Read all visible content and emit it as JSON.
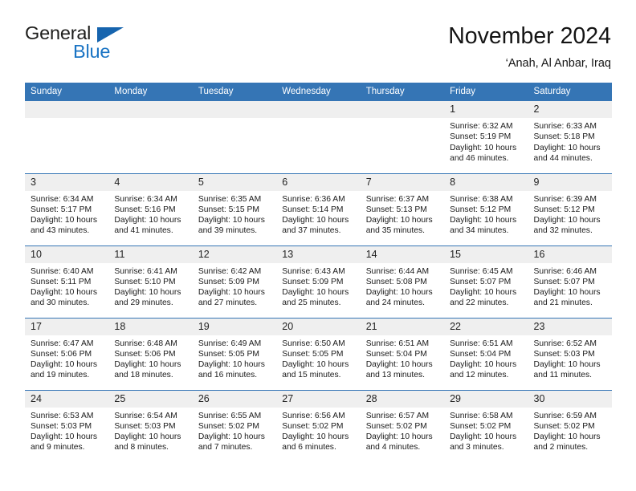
{
  "brand": {
    "name_part1": "General",
    "name_part2": "Blue",
    "triangle_icon": "triangle-icon",
    "color_dark": "#1d1d1b",
    "color_blue": "#1a74c4"
  },
  "header": {
    "title": "November 2024",
    "subtitle": "‘Anah, Al Anbar, Iraq",
    "accent_color": "#3575b5",
    "daynum_bg": "#efefef"
  },
  "weekday_headers": [
    "Sunday",
    "Monday",
    "Tuesday",
    "Wednesday",
    "Thursday",
    "Friday",
    "Saturday"
  ],
  "weeks": [
    [
      {
        "day": "",
        "sunrise": "",
        "sunset": "",
        "daylight_line1": "",
        "daylight_line2": ""
      },
      {
        "day": "",
        "sunrise": "",
        "sunset": "",
        "daylight_line1": "",
        "daylight_line2": ""
      },
      {
        "day": "",
        "sunrise": "",
        "sunset": "",
        "daylight_line1": "",
        "daylight_line2": ""
      },
      {
        "day": "",
        "sunrise": "",
        "sunset": "",
        "daylight_line1": "",
        "daylight_line2": ""
      },
      {
        "day": "",
        "sunrise": "",
        "sunset": "",
        "daylight_line1": "",
        "daylight_line2": ""
      },
      {
        "day": "1",
        "sunrise": "Sunrise: 6:32 AM",
        "sunset": "Sunset: 5:19 PM",
        "daylight_line1": "Daylight: 10 hours",
        "daylight_line2": "and 46 minutes."
      },
      {
        "day": "2",
        "sunrise": "Sunrise: 6:33 AM",
        "sunset": "Sunset: 5:18 PM",
        "daylight_line1": "Daylight: 10 hours",
        "daylight_line2": "and 44 minutes."
      }
    ],
    [
      {
        "day": "3",
        "sunrise": "Sunrise: 6:34 AM",
        "sunset": "Sunset: 5:17 PM",
        "daylight_line1": "Daylight: 10 hours",
        "daylight_line2": "and 43 minutes."
      },
      {
        "day": "4",
        "sunrise": "Sunrise: 6:34 AM",
        "sunset": "Sunset: 5:16 PM",
        "daylight_line1": "Daylight: 10 hours",
        "daylight_line2": "and 41 minutes."
      },
      {
        "day": "5",
        "sunrise": "Sunrise: 6:35 AM",
        "sunset": "Sunset: 5:15 PM",
        "daylight_line1": "Daylight: 10 hours",
        "daylight_line2": "and 39 minutes."
      },
      {
        "day": "6",
        "sunrise": "Sunrise: 6:36 AM",
        "sunset": "Sunset: 5:14 PM",
        "daylight_line1": "Daylight: 10 hours",
        "daylight_line2": "and 37 minutes."
      },
      {
        "day": "7",
        "sunrise": "Sunrise: 6:37 AM",
        "sunset": "Sunset: 5:13 PM",
        "daylight_line1": "Daylight: 10 hours",
        "daylight_line2": "and 35 minutes."
      },
      {
        "day": "8",
        "sunrise": "Sunrise: 6:38 AM",
        "sunset": "Sunset: 5:12 PM",
        "daylight_line1": "Daylight: 10 hours",
        "daylight_line2": "and 34 minutes."
      },
      {
        "day": "9",
        "sunrise": "Sunrise: 6:39 AM",
        "sunset": "Sunset: 5:12 PM",
        "daylight_line1": "Daylight: 10 hours",
        "daylight_line2": "and 32 minutes."
      }
    ],
    [
      {
        "day": "10",
        "sunrise": "Sunrise: 6:40 AM",
        "sunset": "Sunset: 5:11 PM",
        "daylight_line1": "Daylight: 10 hours",
        "daylight_line2": "and 30 minutes."
      },
      {
        "day": "11",
        "sunrise": "Sunrise: 6:41 AM",
        "sunset": "Sunset: 5:10 PM",
        "daylight_line1": "Daylight: 10 hours",
        "daylight_line2": "and 29 minutes."
      },
      {
        "day": "12",
        "sunrise": "Sunrise: 6:42 AM",
        "sunset": "Sunset: 5:09 PM",
        "daylight_line1": "Daylight: 10 hours",
        "daylight_line2": "and 27 minutes."
      },
      {
        "day": "13",
        "sunrise": "Sunrise: 6:43 AM",
        "sunset": "Sunset: 5:09 PM",
        "daylight_line1": "Daylight: 10 hours",
        "daylight_line2": "and 25 minutes."
      },
      {
        "day": "14",
        "sunrise": "Sunrise: 6:44 AM",
        "sunset": "Sunset: 5:08 PM",
        "daylight_line1": "Daylight: 10 hours",
        "daylight_line2": "and 24 minutes."
      },
      {
        "day": "15",
        "sunrise": "Sunrise: 6:45 AM",
        "sunset": "Sunset: 5:07 PM",
        "daylight_line1": "Daylight: 10 hours",
        "daylight_line2": "and 22 minutes."
      },
      {
        "day": "16",
        "sunrise": "Sunrise: 6:46 AM",
        "sunset": "Sunset: 5:07 PM",
        "daylight_line1": "Daylight: 10 hours",
        "daylight_line2": "and 21 minutes."
      }
    ],
    [
      {
        "day": "17",
        "sunrise": "Sunrise: 6:47 AM",
        "sunset": "Sunset: 5:06 PM",
        "daylight_line1": "Daylight: 10 hours",
        "daylight_line2": "and 19 minutes."
      },
      {
        "day": "18",
        "sunrise": "Sunrise: 6:48 AM",
        "sunset": "Sunset: 5:06 PM",
        "daylight_line1": "Daylight: 10 hours",
        "daylight_line2": "and 18 minutes."
      },
      {
        "day": "19",
        "sunrise": "Sunrise: 6:49 AM",
        "sunset": "Sunset: 5:05 PM",
        "daylight_line1": "Daylight: 10 hours",
        "daylight_line2": "and 16 minutes."
      },
      {
        "day": "20",
        "sunrise": "Sunrise: 6:50 AM",
        "sunset": "Sunset: 5:05 PM",
        "daylight_line1": "Daylight: 10 hours",
        "daylight_line2": "and 15 minutes."
      },
      {
        "day": "21",
        "sunrise": "Sunrise: 6:51 AM",
        "sunset": "Sunset: 5:04 PM",
        "daylight_line1": "Daylight: 10 hours",
        "daylight_line2": "and 13 minutes."
      },
      {
        "day": "22",
        "sunrise": "Sunrise: 6:51 AM",
        "sunset": "Sunset: 5:04 PM",
        "daylight_line1": "Daylight: 10 hours",
        "daylight_line2": "and 12 minutes."
      },
      {
        "day": "23",
        "sunrise": "Sunrise: 6:52 AM",
        "sunset": "Sunset: 5:03 PM",
        "daylight_line1": "Daylight: 10 hours",
        "daylight_line2": "and 11 minutes."
      }
    ],
    [
      {
        "day": "24",
        "sunrise": "Sunrise: 6:53 AM",
        "sunset": "Sunset: 5:03 PM",
        "daylight_line1": "Daylight: 10 hours",
        "daylight_line2": "and 9 minutes."
      },
      {
        "day": "25",
        "sunrise": "Sunrise: 6:54 AM",
        "sunset": "Sunset: 5:03 PM",
        "daylight_line1": "Daylight: 10 hours",
        "daylight_line2": "and 8 minutes."
      },
      {
        "day": "26",
        "sunrise": "Sunrise: 6:55 AM",
        "sunset": "Sunset: 5:02 PM",
        "daylight_line1": "Daylight: 10 hours",
        "daylight_line2": "and 7 minutes."
      },
      {
        "day": "27",
        "sunrise": "Sunrise: 6:56 AM",
        "sunset": "Sunset: 5:02 PM",
        "daylight_line1": "Daylight: 10 hours",
        "daylight_line2": "and 6 minutes."
      },
      {
        "day": "28",
        "sunrise": "Sunrise: 6:57 AM",
        "sunset": "Sunset: 5:02 PM",
        "daylight_line1": "Daylight: 10 hours",
        "daylight_line2": "and 4 minutes."
      },
      {
        "day": "29",
        "sunrise": "Sunrise: 6:58 AM",
        "sunset": "Sunset: 5:02 PM",
        "daylight_line1": "Daylight: 10 hours",
        "daylight_line2": "and 3 minutes."
      },
      {
        "day": "30",
        "sunrise": "Sunrise: 6:59 AM",
        "sunset": "Sunset: 5:02 PM",
        "daylight_line1": "Daylight: 10 hours",
        "daylight_line2": "and 2 minutes."
      }
    ]
  ]
}
